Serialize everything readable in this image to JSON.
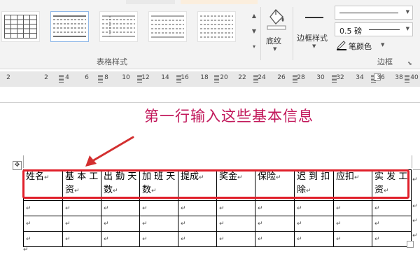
{
  "ribbon": {
    "table_styles_group_label": "表格样式",
    "shading_label": "底纹",
    "border_styles_label": "边框样式",
    "line_weight_value": "0.5 磅",
    "pen_color_label": "笔颜色",
    "borders_group_label": "边框",
    "pen_color": "#000000"
  },
  "ruler": {
    "ticks": [
      "2",
      "2",
      "4",
      "6",
      "8",
      "10",
      "12",
      "14",
      "16",
      "18",
      "20",
      "22",
      "24",
      "26",
      "28",
      "30",
      "32",
      "34",
      "36",
      "38",
      "40"
    ]
  },
  "annotation": {
    "text": "第一行输入这些基本信息",
    "color": "#c2185b",
    "arrow_color": "#d32f2f"
  },
  "table": {
    "headers": [
      "姓名",
      "基 本 工资",
      "出 勤 天数",
      "加 班 天数",
      "提成",
      "奖金",
      "保险",
      "迟 到 扣除",
      "应扣",
      "实 发 工资"
    ],
    "highlight_color": "#e01f2a"
  },
  "marks": {
    "paragraph": "↵",
    "table_move": "✥"
  }
}
